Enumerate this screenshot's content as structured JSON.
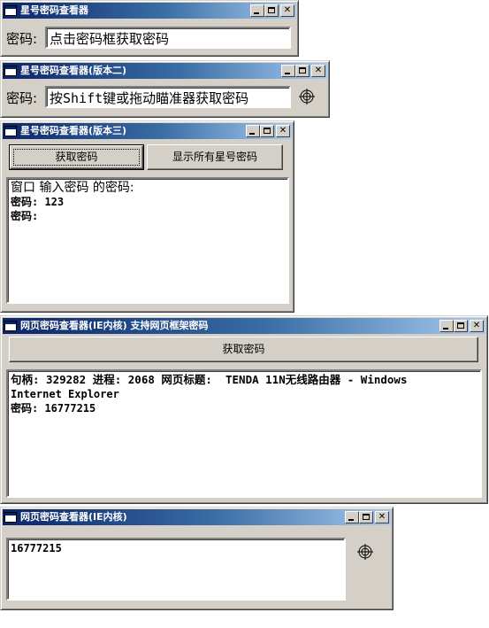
{
  "windows": [
    {
      "title": "星号密码查看器",
      "label": "密码:",
      "field_value": "点击密码框获取密码"
    },
    {
      "title": "星号密码查看器(版本二)",
      "label": "密码:",
      "field_value": "按Shift键或拖动瞄准器获取密码"
    },
    {
      "title": "星号密码查看器(版本三)",
      "button_get": "获取密码",
      "button_show_all": "显示所有星号密码",
      "lines": [
        "窗口 输入密码 的密码:",
        "密码: 123",
        "密码:"
      ]
    },
    {
      "title": "网页密码查看器(IE内核)  支持网页框架密码",
      "button_get": "获取密码",
      "lines": [
        "句柄: 329282 进程: 2068 网页标题:  TENDA 11N无线路由器 - Windows",
        "Internet Explorer",
        "密码: 16777215"
      ]
    },
    {
      "title": "网页密码查看器(IE内核)",
      "lines": [
        "16777215"
      ]
    }
  ],
  "titlebar_gradient": [
    "#0a246a",
    "#a6caf0"
  ],
  "window_face_color": "#d4d0c8",
  "icons": {
    "minimize": "minimize-icon",
    "maximize": "maximize-icon",
    "close": "close-icon",
    "crosshair": "crosshair-icon"
  }
}
